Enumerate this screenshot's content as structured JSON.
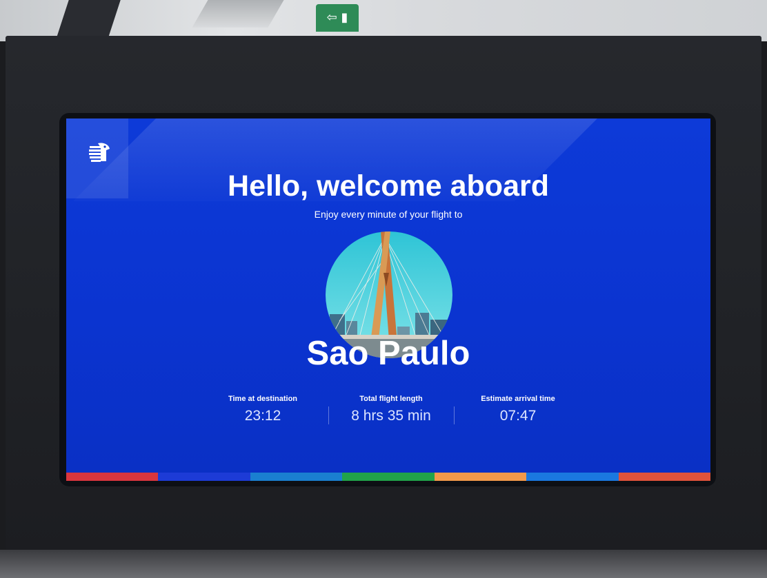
{
  "screen": {
    "title": "Hello, welcome aboard",
    "subtitle": "Enjoy every minute of your flight to",
    "destination": "Sao Paulo"
  },
  "stats": [
    {
      "label": "Time at destination",
      "value": "23:12"
    },
    {
      "label": "Total flight length",
      "value": "8 hrs 35 min"
    },
    {
      "label": "Estimate arrival time",
      "value": "07:47"
    }
  ],
  "environment": {
    "exit_sign_icon": "exit-arrow-icon"
  },
  "colors": {
    "screen_background": "#0b34d0",
    "text": "#ffffff",
    "accent_bar": [
      "#d9363e",
      "#1d3bd6",
      "#1a7fd0",
      "#21a34a",
      "#f2994a",
      "#1a78e0",
      "#e0533b"
    ]
  }
}
